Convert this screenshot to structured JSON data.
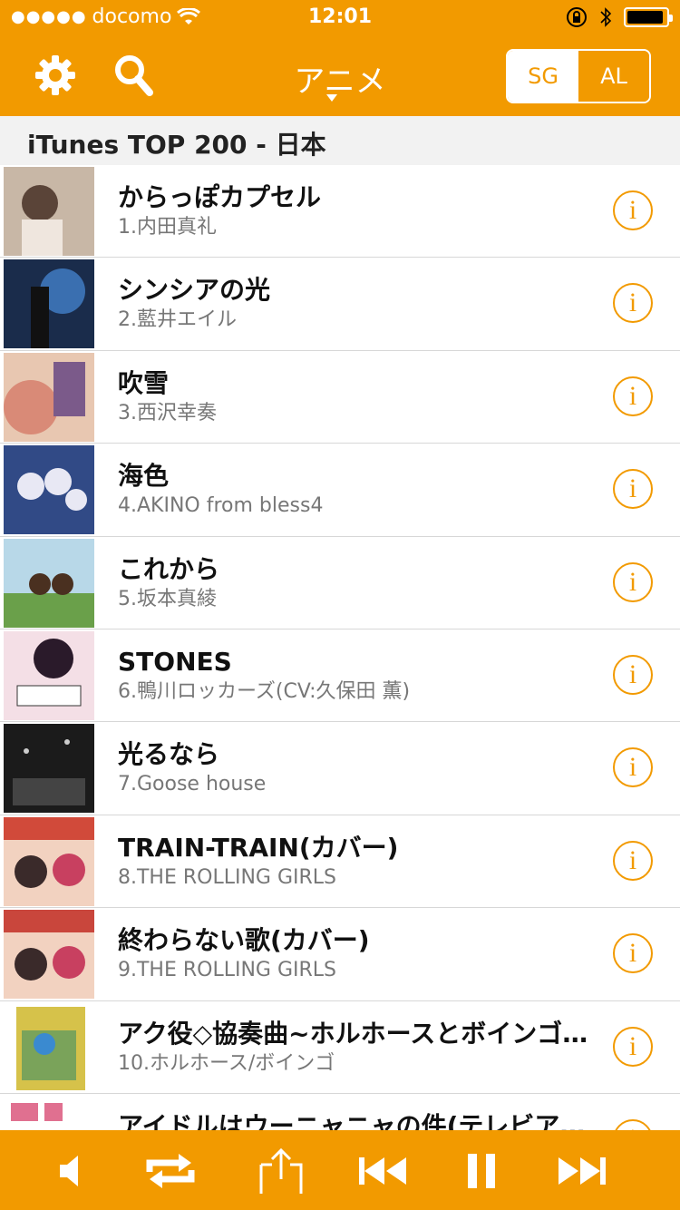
{
  "status": {
    "carrier": "docomo",
    "time": "12:01"
  },
  "header": {
    "title": "アニメ",
    "seg_sg": "SG",
    "seg_al": "AL"
  },
  "section": {
    "title": "iTunes TOP 200 - 日本"
  },
  "colors": {
    "accent": "#f29a00"
  },
  "songs": [
    {
      "title": "からっぽカプセル",
      "artist": "1.内田真礼",
      "art": "#c8b7a6"
    },
    {
      "title": "シンシアの光",
      "artist": "2.藍井エイル",
      "art": "#1a2c4b"
    },
    {
      "title": "吹雪",
      "artist": "3.西沢幸奏",
      "art": "#d98a77"
    },
    {
      "title": "海色",
      "artist": "4.AKINO from bless4",
      "art": "#314a86"
    },
    {
      "title": "これから",
      "artist": "5.坂本真綾",
      "art": "#7fb0c8"
    },
    {
      "title": "STONES",
      "artist": "6.鴨川ロッカーズ(CV:久保田 薫)",
      "art": "#c03a4a"
    },
    {
      "title": "光るなら",
      "artist": "7.Goose house",
      "art": "#1b1b1b"
    },
    {
      "title": "TRAIN-TRAIN(カバー)",
      "artist": "8.THE ROLLING GIRLS",
      "art": "#d14a3a"
    },
    {
      "title": "終わらない歌(カバー)",
      "artist": "9.THE ROLLING GIRLS",
      "art": "#c9463c"
    },
    {
      "title": "アク役◇協奏曲~ホルホースとボインゴ…",
      "artist": "10.ホルホース/ボインゴ",
      "art": "#7aa35a"
    },
    {
      "title": "アイドルはウーニャニャの件(テレビア…",
      "artist": "",
      "art": "#e07090"
    }
  ]
}
